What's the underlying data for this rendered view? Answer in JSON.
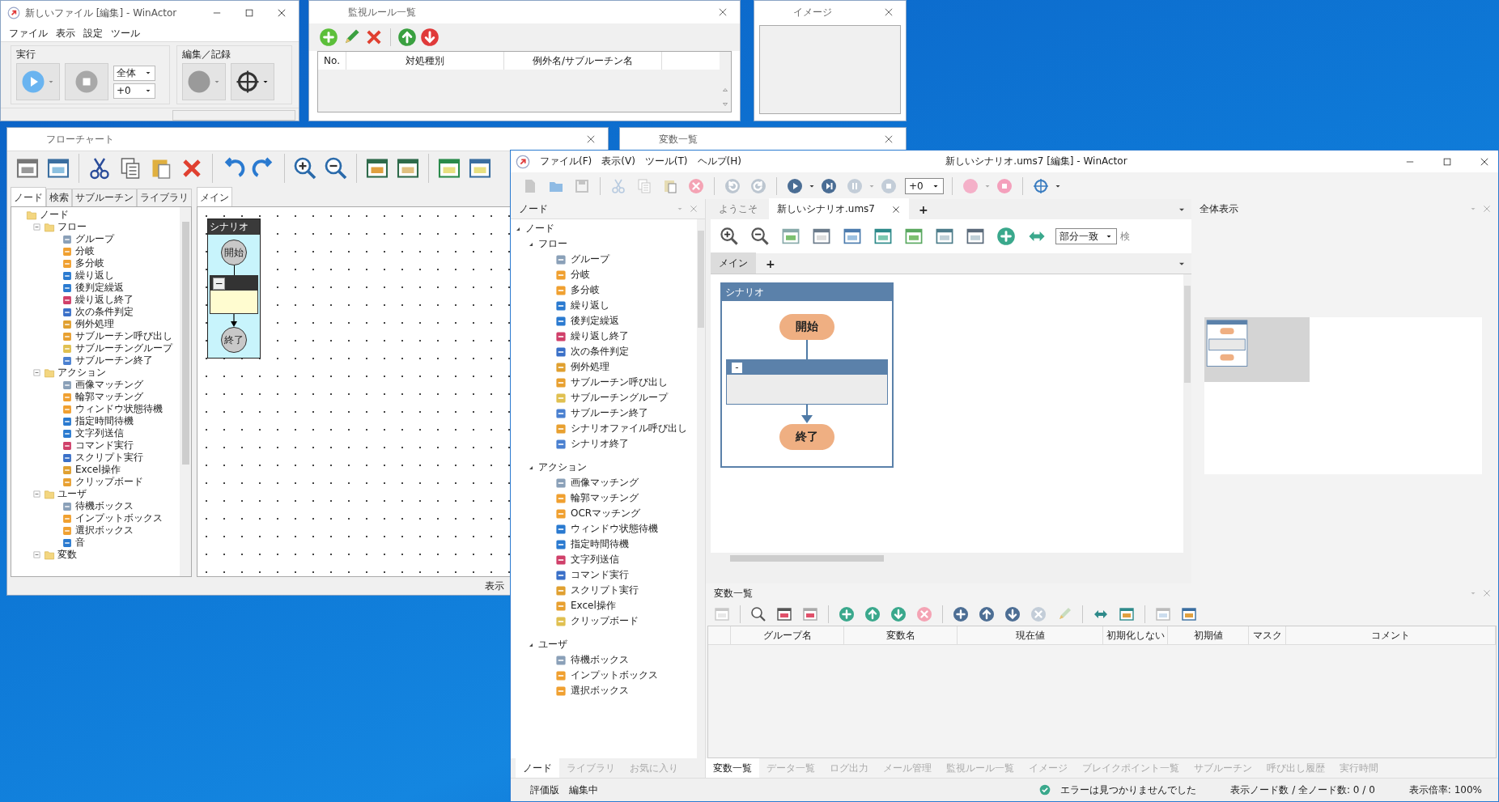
{
  "file_window": {
    "title": "新しいファイル [編集] - WinActor",
    "menu": [
      "ファイル",
      "表示",
      "設定",
      "ツール"
    ],
    "run_group": {
      "label": "実行",
      "scope": "全体",
      "offset": "+0"
    },
    "edit_group": {
      "label": "編集／記録"
    }
  },
  "monitor_window": {
    "title": "監視ルール一覧",
    "columns": [
      "No.",
      "対処種別",
      "例外名/サブルーチン名"
    ]
  },
  "image_window": {
    "title": "イメージ"
  },
  "flowchart_window": {
    "title": "フローチャート",
    "tabs": [
      {
        "label": "ノード",
        "selected": true
      },
      {
        "label": "検索",
        "selected": false
      },
      {
        "label": "サブルーチン",
        "selected": false
      },
      {
        "label": "ライブラリ",
        "selected": false
      }
    ],
    "tree": [
      {
        "label": "ノード",
        "children": [
          {
            "label": "フロー",
            "expanded": true,
            "children": [
              {
                "label": "グループ"
              },
              {
                "label": "分岐"
              },
              {
                "label": "多分岐"
              },
              {
                "label": "繰り返し"
              },
              {
                "label": "後判定繰返"
              },
              {
                "label": "繰り返し終了"
              },
              {
                "label": "次の条件判定"
              },
              {
                "label": "例外処理"
              },
              {
                "label": "サブルーチン呼び出し"
              },
              {
                "label": "サブルーチングループ"
              },
              {
                "label": "サブルーチン終了"
              }
            ]
          },
          {
            "label": "アクション",
            "expanded": true,
            "children": [
              {
                "label": "画像マッチング"
              },
              {
                "label": "輪郭マッチング"
              },
              {
                "label": "ウィンドウ状態待機"
              },
              {
                "label": "指定時間待機"
              },
              {
                "label": "文字列送信"
              },
              {
                "label": "コマンド実行"
              },
              {
                "label": "スクリプト実行"
              },
              {
                "label": "Excel操作"
              },
              {
                "label": "クリップボード"
              }
            ]
          },
          {
            "label": "ユーザ",
            "expanded": true,
            "children": [
              {
                "label": "待機ボックス"
              },
              {
                "label": "インプットボックス"
              },
              {
                "label": "選択ボックス"
              },
              {
                "label": "音"
              }
            ]
          },
          {
            "label": "変数",
            "expanded": true
          }
        ]
      }
    ],
    "canvas_tabs": [
      {
        "label": "メイン",
        "selected": true
      }
    ],
    "scenario": {
      "title": "シナリオ",
      "start": "開始",
      "collapse": "−",
      "end": "終了"
    },
    "status": "表示"
  },
  "variables_window": {
    "title": "変数一覧"
  },
  "main_window": {
    "title": "新しいシナリオ.ums7 [編集] - WinActor",
    "menu": [
      "ファイル(F)",
      "表示(V)",
      "ツール(T)",
      "ヘルプ(H)"
    ],
    "offset": "+0",
    "node_panel": {
      "title": "ノード",
      "tree": [
        {
          "label": "ノード",
          "expanded": true,
          "children": [
            {
              "label": "フロー",
              "expanded": true,
              "children": [
                {
                  "label": "グループ"
                },
                {
                  "label": "分岐"
                },
                {
                  "label": "多分岐"
                },
                {
                  "label": "繰り返し"
                },
                {
                  "label": "後判定繰返"
                },
                {
                  "label": "繰り返し終了"
                },
                {
                  "label": "次の条件判定"
                },
                {
                  "label": "例外処理"
                },
                {
                  "label": "サブルーチン呼び出し"
                },
                {
                  "label": "サブルーチングループ"
                },
                {
                  "label": "サブルーチン終了"
                },
                {
                  "label": "シナリオファイル呼び出し"
                },
                {
                  "label": "シナリオ終了"
                }
              ]
            },
            {
              "label": "アクション",
              "expanded": true,
              "children": [
                {
                  "label": "画像マッチング"
                },
                {
                  "label": "輪郭マッチング"
                },
                {
                  "label": "OCRマッチング"
                },
                {
                  "label": "ウィンドウ状態待機"
                },
                {
                  "label": "指定時間待機"
                },
                {
                  "label": "文字列送信"
                },
                {
                  "label": "コマンド実行"
                },
                {
                  "label": "スクリプト実行"
                },
                {
                  "label": "Excel操作"
                },
                {
                  "label": "クリップボード"
                }
              ]
            },
            {
              "label": "ユーザ",
              "expanded": true,
              "children": [
                {
                  "label": "待機ボックス"
                },
                {
                  "label": "インプットボックス"
                },
                {
                  "label": "選択ボックス"
                }
              ]
            }
          ]
        }
      ],
      "tabs": [
        {
          "label": "ノード",
          "selected": true
        },
        {
          "label": "ライブラリ",
          "selected": false
        },
        {
          "label": "お気に入り",
          "selected": false
        }
      ]
    },
    "doc_tabs": [
      {
        "label": "ようこそ",
        "selected": false,
        "closable": false
      },
      {
        "label": "新しいシナリオ.ums7",
        "selected": true,
        "closable": true
      }
    ],
    "add_tab": "+",
    "match_mode": "部分一致",
    "search_label": "検",
    "sheet_tabs": [
      {
        "label": "メイン",
        "selected": true
      }
    ],
    "add_sheet": "+",
    "scenario": {
      "title": "シナリオ",
      "start": "開始",
      "collapse": "-",
      "end": "終了"
    },
    "overview_panel": {
      "title": "全体表示"
    },
    "variables_panel": {
      "title": "変数一覧",
      "columns": [
        "グループ名",
        "変数名",
        "現在値",
        "初期化しない",
        "初期値",
        "マスク",
        "コメント"
      ]
    },
    "bottom_tabs": [
      {
        "label": "変数一覧",
        "selected": true
      },
      {
        "label": "データ一覧",
        "selected": false
      },
      {
        "label": "ログ出力",
        "selected": false
      },
      {
        "label": "メール管理",
        "selected": false
      },
      {
        "label": "監視ルール一覧",
        "selected": false
      },
      {
        "label": "イメージ",
        "selected": false
      },
      {
        "label": "ブレイクポイント一覧",
        "selected": false
      },
      {
        "label": "サブルーチン",
        "selected": false
      },
      {
        "label": "呼び出し履歴",
        "selected": false
      },
      {
        "label": "実行時間",
        "selected": false
      }
    ],
    "status_bar": {
      "edition": "評価版",
      "mode": "編集中",
      "message": "エラーは見つかりませんでした",
      "node_count": "表示ノード数 / 全ノード数: 0 / 0",
      "zoom": "表示倍率: 100%"
    }
  }
}
